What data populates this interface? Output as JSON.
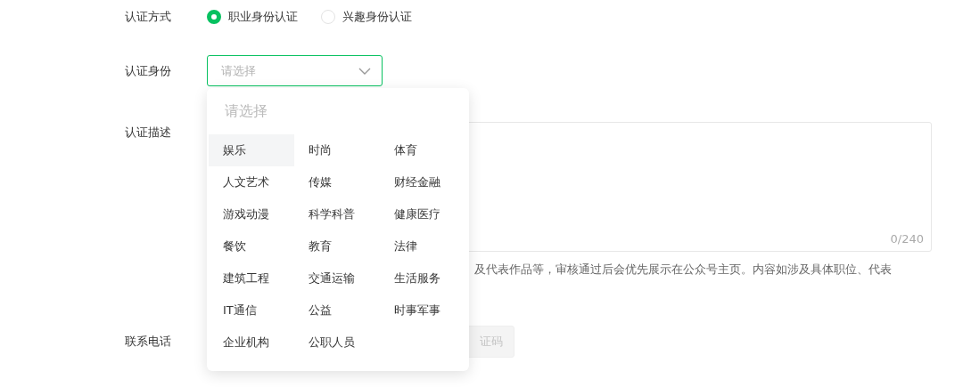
{
  "auth_method": {
    "label": "认证方式",
    "options": [
      {
        "label": "职业身份认证",
        "selected": true
      },
      {
        "label": "兴趣身份认证",
        "selected": false
      }
    ]
  },
  "auth_identity": {
    "label": "认证身份",
    "placeholder": "请选择",
    "expanded": true
  },
  "dropdown": {
    "header": "请选择",
    "items": [
      {
        "label": "娱乐",
        "hovered": true
      },
      {
        "label": "时尚",
        "hovered": false
      },
      {
        "label": "体育",
        "hovered": false
      },
      {
        "label": "人文艺术",
        "hovered": false
      },
      {
        "label": "传媒",
        "hovered": false
      },
      {
        "label": "财经金融",
        "hovered": false
      },
      {
        "label": "游戏动漫",
        "hovered": false
      },
      {
        "label": "科学科普",
        "hovered": false
      },
      {
        "label": "健康医疗",
        "hovered": false
      },
      {
        "label": "餐饮",
        "hovered": false
      },
      {
        "label": "教育",
        "hovered": false
      },
      {
        "label": "法律",
        "hovered": false
      },
      {
        "label": "建筑工程",
        "hovered": false
      },
      {
        "label": "交通运输",
        "hovered": false
      },
      {
        "label": "生活服务",
        "hovered": false
      },
      {
        "label": "IT通信",
        "hovered": false
      },
      {
        "label": "公益",
        "hovered": false
      },
      {
        "label": "时事军事",
        "hovered": false
      },
      {
        "label": "企业机构",
        "hovered": false
      },
      {
        "label": "公职人员",
        "hovered": false
      }
    ]
  },
  "auth_description": {
    "label": "认证描述",
    "counter": "0/240",
    "hint": "及代表作品等，审核通过后会优先展示在公众号主页。内容如涉及具体职位、代表"
  },
  "phone": {
    "label": "联系电话",
    "code_button": "证码"
  }
}
